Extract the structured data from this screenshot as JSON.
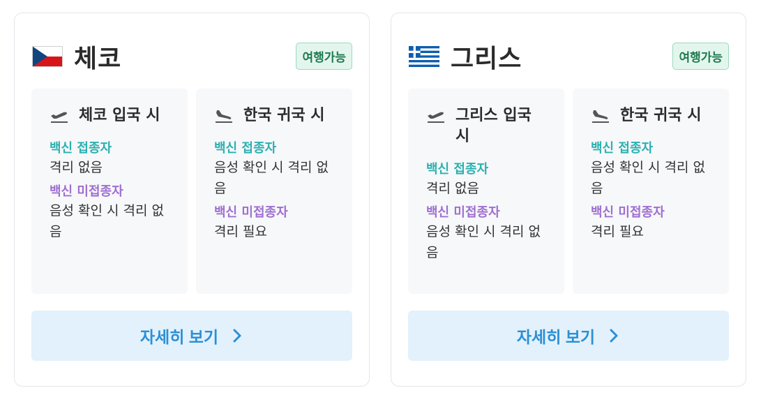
{
  "cards": [
    {
      "country": "체코",
      "flag_icon": "czech-flag-icon",
      "status_badge": "여행가능",
      "entry": {
        "title": "체코 입국 시",
        "vaccinated_label": "백신 접종자",
        "vaccinated_value": "격리 없음",
        "unvaccinated_label": "백신 미접종자",
        "unvaccinated_value": "음성 확인 시 격리 없음"
      },
      "return": {
        "title": "한국 귀국 시",
        "vaccinated_label": "백신 접종자",
        "vaccinated_value": "음성 확인 시 격리 없음",
        "unvaccinated_label": "백신 미접종자",
        "unvaccinated_value": "격리 필요"
      },
      "detail_button": "자세히 보기"
    },
    {
      "country": "그리스",
      "flag_icon": "greece-flag-icon",
      "status_badge": "여행가능",
      "entry": {
        "title": "그리스 입국 시",
        "vaccinated_label": "백신 접종자",
        "vaccinated_value": "격리 없음",
        "unvaccinated_label": "백신 미접종자",
        "unvaccinated_value": "음성 확인 시 격리 없음"
      },
      "return": {
        "title": "한국 귀국 시",
        "vaccinated_label": "백신 접종자",
        "vaccinated_value": "음성 확인 시 격리 없음",
        "unvaccinated_label": "백신 미접종자",
        "unvaccinated_value": "격리 필요"
      },
      "detail_button": "자세히 보기"
    }
  ],
  "colors": {
    "badge_text": "#1e7a4f",
    "badge_bg": "#e3f6ee",
    "vaccinated": "#2bb0b0",
    "unvaccinated": "#a06ed0",
    "button_text": "#2b8fd6",
    "button_bg": "#e2f1fb"
  }
}
